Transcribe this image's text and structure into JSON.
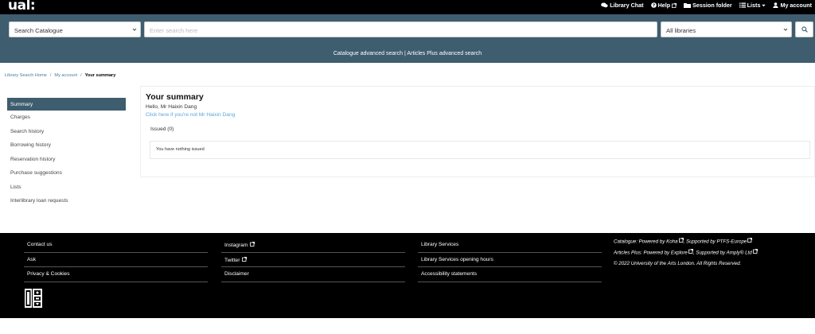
{
  "header": {
    "logo": "ual:",
    "links": [
      {
        "label": "Library Chat",
        "icon": "chat-icon"
      },
      {
        "label": "Help",
        "icon": "help-icon"
      },
      {
        "label": "Session folder",
        "icon": "folder-icon"
      },
      {
        "label": "Lists",
        "icon": "list-icon"
      },
      {
        "label": "My account",
        "icon": "user-icon"
      }
    ]
  },
  "search": {
    "scope_selected": "Search Catalogue",
    "placeholder": "Enter search here",
    "library_selected": "All libraries",
    "advanced_catalogue": "Catalogue advanced search",
    "advanced_separator": "|",
    "advanced_articles": "Articles Plus advanced search"
  },
  "breadcrumb": {
    "home": "Library Search Home",
    "account": "My account",
    "current": "Your summary",
    "separator": "/"
  },
  "sidebar": {
    "items": [
      {
        "label": "Summary"
      },
      {
        "label": "Charges"
      },
      {
        "label": "Search history"
      },
      {
        "label": "Borrowing history"
      },
      {
        "label": "Reservation history"
      },
      {
        "label": "Purchase suggestions"
      },
      {
        "label": "Lists"
      },
      {
        "label": "Interlibrary loan requests"
      }
    ]
  },
  "summary": {
    "title": "Your summary",
    "greeting": "Hello, Mr Haixin Dang",
    "not_you": "Click here if you're not Mr Haixin Dang",
    "issued_tab": "Issued (0)",
    "issued_empty": "You have nothing issued"
  },
  "footer": {
    "col1": [
      "Contact us",
      "Ask",
      "Privacy & Cookies"
    ],
    "col2": [
      "Instagram",
      "Twitter",
      "Disclaimer"
    ],
    "col3": [
      "Library Services",
      "Library Services opening hours",
      "Accessibility statements"
    ],
    "credits": {
      "catalogue_prefix": "Catalogue: Powered by",
      "koha": "Koha",
      "catalogue_supported": ", Supported by",
      "ptfs": "PTFS-Europe",
      "articles_prefix": "Articles Plus: Powered by",
      "exlibris": "Explore",
      "articles_supported": ", Supported by",
      "amply": "Amply® Ltd",
      "copyright": "© 2022 University of the Arts London. All Rights Reserved."
    }
  },
  "colors": {
    "accent": "#3e5d6f",
    "link": "#5aa6d6",
    "footer_bg": "#000000"
  }
}
